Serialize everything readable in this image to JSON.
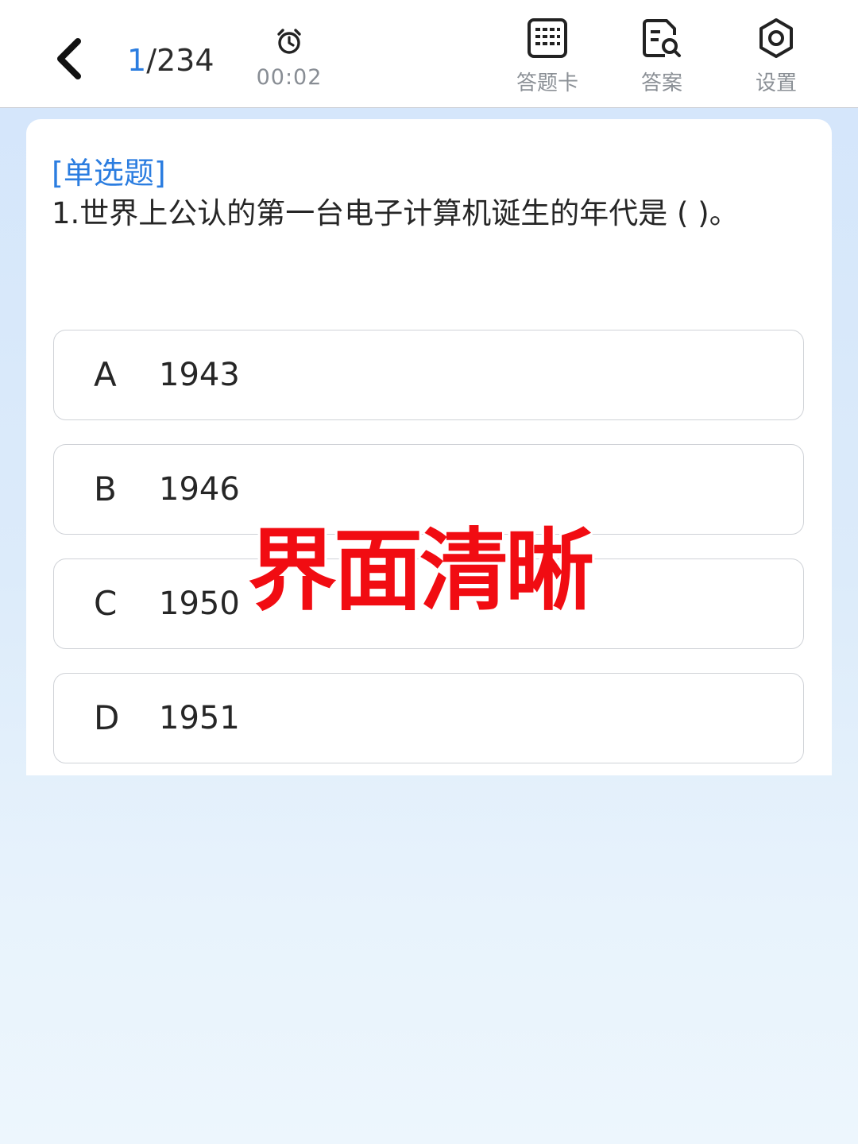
{
  "header": {
    "progress_current": "1",
    "progress_total": "/234",
    "timer": "00:02",
    "tools": {
      "answer_card": "答题卡",
      "answer": "答案",
      "settings": "设置"
    }
  },
  "question": {
    "type": "[单选题]",
    "text": "1.世界上公认的第一台电子计算机诞生的年代是 (  )。",
    "options": [
      {
        "letter": "A",
        "value": "1943"
      },
      {
        "letter": "B",
        "value": "1946"
      },
      {
        "letter": "C",
        "value": "1950"
      },
      {
        "letter": "D",
        "value": "1951"
      }
    ]
  },
  "overlay_text": "界面清晰",
  "icons": {
    "back": "chevron-left-icon",
    "timer": "alarm-clock-icon",
    "answer_card": "grid-card-icon",
    "answer": "document-search-icon",
    "settings": "gear-icon"
  },
  "colors": {
    "accent": "#2b7de0",
    "overlay": "#f10c12",
    "text": "#262626",
    "muted": "#888d94"
  }
}
